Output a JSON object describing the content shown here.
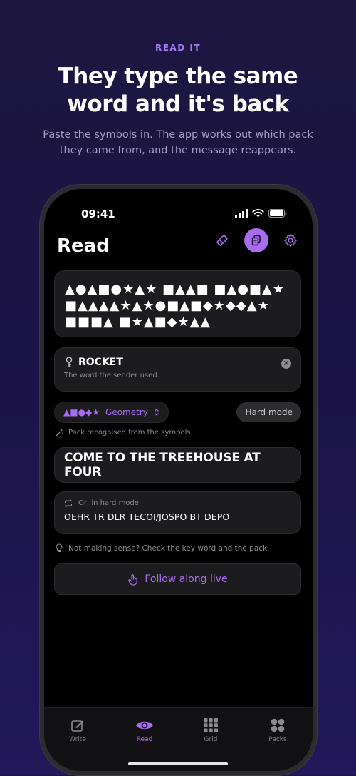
{
  "marketing": {
    "eyebrow": "READ IT",
    "headline_line1": "They type the same",
    "headline_line2": "word and it's back",
    "subhead_line1": "Paste the symbols in. The app works out which pack",
    "subhead_line2": "they came from, and the message reappears."
  },
  "status_bar": {
    "time": "09:41"
  },
  "screen": {
    "title": "Read",
    "top_icons": [
      "eraser-icon",
      "paste-icon",
      "gear-icon"
    ],
    "symbols": {
      "line1": "▲●▲■●★▲★ ■▲▲■ ■▲●■▲★",
      "line2": "■▲▲▲▲★▲★●■▲■◆★◆◆▲★",
      "line3": "■■■▲ ■★▲■◆★▲▲"
    },
    "keyword": {
      "value": "ROCKET",
      "hint": "The word the sender used."
    },
    "pack": {
      "shapes": "▲■●◆★",
      "name": "Geometry",
      "hard_mode_label": "Hard mode",
      "hint": "Pack recognised from the symbols."
    },
    "message": "COME TO THE TREEHOUSE AT FOUR",
    "hard_mode": {
      "label": "Or, in hard mode",
      "value": "OEHR TR DLR TECOI/JOSPO BT DEPO"
    },
    "help_text": "Not making sense? Check the key word and the pack.",
    "follow_button": "Follow along live"
  },
  "tabbar": {
    "tabs": [
      {
        "label": "Write",
        "icon": "pencil-square-icon",
        "active": false
      },
      {
        "label": "Read",
        "icon": "eye-icon",
        "active": true
      },
      {
        "label": "Grid",
        "icon": "grid-icon",
        "active": false
      },
      {
        "label": "Packs",
        "icon": "four-circles-icon",
        "active": false
      }
    ]
  },
  "colors": {
    "accent": "#a86cf0",
    "background_top": "#1d1640",
    "background_bottom": "#22185a",
    "card": "#1c1c1e"
  }
}
